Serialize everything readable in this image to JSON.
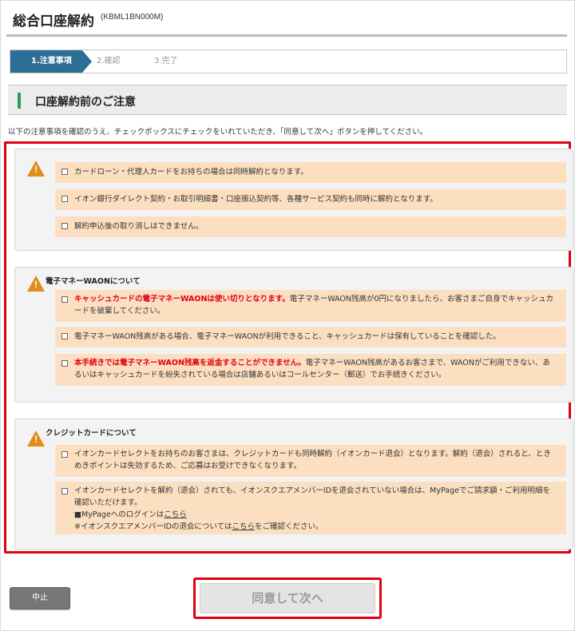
{
  "header": {
    "title": "総合口座解約",
    "code": "(KBML1BN000M)"
  },
  "steps": [
    {
      "label": "1.注意事項",
      "active": true
    },
    {
      "label": "2.確認",
      "active": false
    },
    {
      "label": "3.完了",
      "active": false
    }
  ],
  "section": {
    "title": "口座解約前のご注意"
  },
  "instruction": "以下の注意事項を確認のうえ、チェックボックスにチェックをいれていただき、「同意して次へ」ボタンを押してください。",
  "groups": [
    {
      "heading": "",
      "items": [
        {
          "text": "カードローン・代理人カードをお持ちの場合は同時解約となります。",
          "checked": false
        },
        {
          "text": "イオン銀行ダイレクト契約・お取引明細書・口座振込契約等、各種サービス契約も同時に解約となります。",
          "checked": false
        },
        {
          "text": "解約申込後の取り消しはできません。",
          "checked": false
        }
      ]
    },
    {
      "heading": "電子マネーWAONについて",
      "items": [
        {
          "emph": "キャッシュカードの電子マネーWAONは使い切りとなります。",
          "text": "電子マネーWAON残高が0円になりましたら、お客さまご自身でキャッシュカードを破棄してください。",
          "checked": false
        },
        {
          "text": "電子マネーWAON残高がある場合、電子マネーWAONが利用できること、キャッシュカードは保有していることを確認した。",
          "checked": false
        },
        {
          "emph": "本手続きでは電子マネーWAON残高を返金することができません。",
          "text": "電子マネーWAON残高があるお客さまで、WAONがご利用できない、あるいはキャッシュカードを紛失されている場合は店舗あるいはコールセンター（郵送）でお手続きください。",
          "checked": false
        }
      ]
    },
    {
      "heading": "クレジットカードについて",
      "items": [
        {
          "text": "イオンカードセレクトをお持ちのお客さまは、クレジットカードも同時解約（イオンカード退会）となります。解約（退会）されると、ときめきポイントは失効するため、ご応募はお受けできなくなります。",
          "checked": false
        },
        {
          "text": "イオンカードセレクトを解約（退会）されても、イオンスクエアメンバーIDを退会されていない場合は、MyPageでご請求額・ご利用明細を確認いただけます。",
          "line2_prefix": "■MyPageへのログインは",
          "line2_link": "こちら",
          "line3_prefix": "※イオンスクエアメンバーIDの退会については",
          "line3_link": "こちら",
          "line3_suffix": "をご確認ください。",
          "checked": false
        }
      ]
    }
  ],
  "buttons": {
    "cancel": "中止",
    "next": "同意して次へ"
  },
  "colors": {
    "accent_blue": "#2d6e96",
    "warning_orange": "#e28c1a",
    "highlight_red": "#e00012",
    "item_bg": "#fbdfc0",
    "section_bar_green": "#2a9d55"
  }
}
